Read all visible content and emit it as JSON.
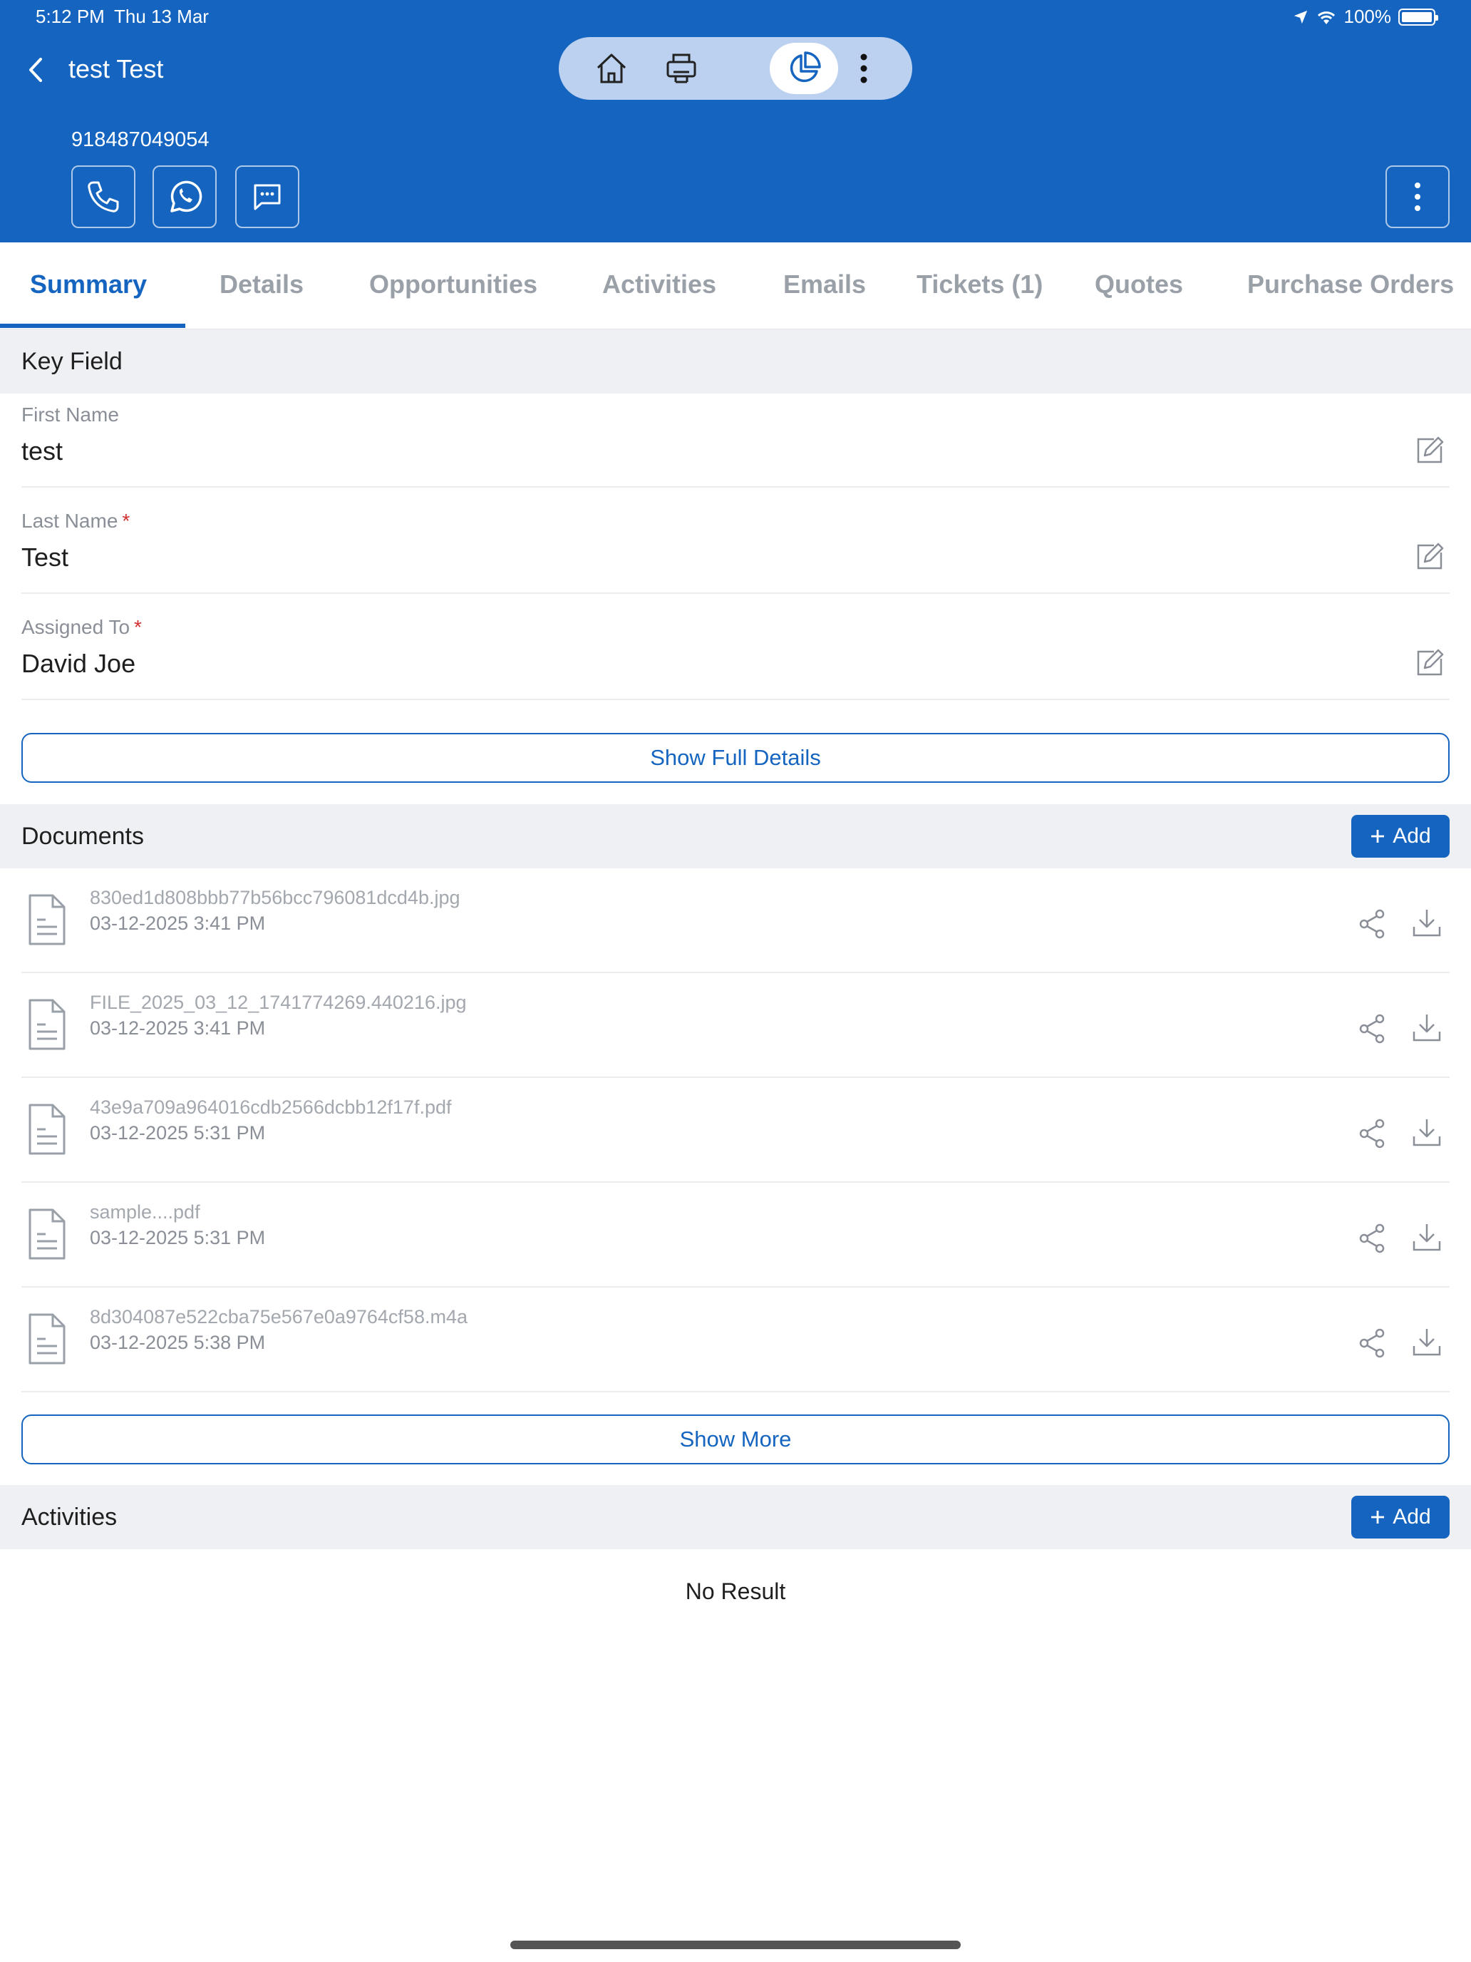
{
  "status_bar": {
    "time": "5:12 PM",
    "date": "Thu 13 Mar",
    "battery": "100%"
  },
  "header": {
    "title": "test Test",
    "phone": "918487049054"
  },
  "toolbar_icons": [
    "home-icon",
    "printer-icon",
    "pie-chart-icon",
    "more-vertical-icon"
  ],
  "contact_actions": [
    "phone-icon",
    "whatsapp-icon",
    "message-icon"
  ],
  "tabs": [
    {
      "label": "Summary",
      "active": true
    },
    {
      "label": "Details"
    },
    {
      "label": "Opportunities"
    },
    {
      "label": "Activities"
    },
    {
      "label": "Emails"
    },
    {
      "label": "Tickets (1)"
    },
    {
      "label": "Quotes"
    },
    {
      "label": "Purchase Orders"
    }
  ],
  "key_field": {
    "title": "Key Field",
    "fields": [
      {
        "label": "First Name",
        "value": "test",
        "required": false
      },
      {
        "label": "Last Name",
        "value": "Test",
        "required": true
      },
      {
        "label": "Assigned To",
        "value": "David Joe",
        "required": true
      }
    ],
    "show_full_label": "Show Full Details"
  },
  "documents": {
    "title": "Documents",
    "add_label": "Add",
    "items": [
      {
        "name": "830ed1d808bbb77b56bcc796081dcd4b.jpg",
        "date": "03-12-2025 3:41 PM"
      },
      {
        "name": "FILE_2025_03_12_1741774269.440216.jpg",
        "date": "03-12-2025 3:41 PM"
      },
      {
        "name": "43e9a709a964016cdb2566dcbb12f17f.pdf",
        "date": "03-12-2025 5:31 PM"
      },
      {
        "name": "sample....pdf",
        "date": "03-12-2025 5:31 PM"
      },
      {
        "name": "8d304087e522cba75e567e0a9764cf58.m4a",
        "date": "03-12-2025 5:38 PM"
      }
    ],
    "show_more_label": "Show More"
  },
  "activities": {
    "title": "Activities",
    "add_label": "Add",
    "empty_text": "No Result"
  },
  "colors": {
    "primary": "#1565c0",
    "section_bg": "#eff0f4",
    "required": "#d32f2f"
  }
}
